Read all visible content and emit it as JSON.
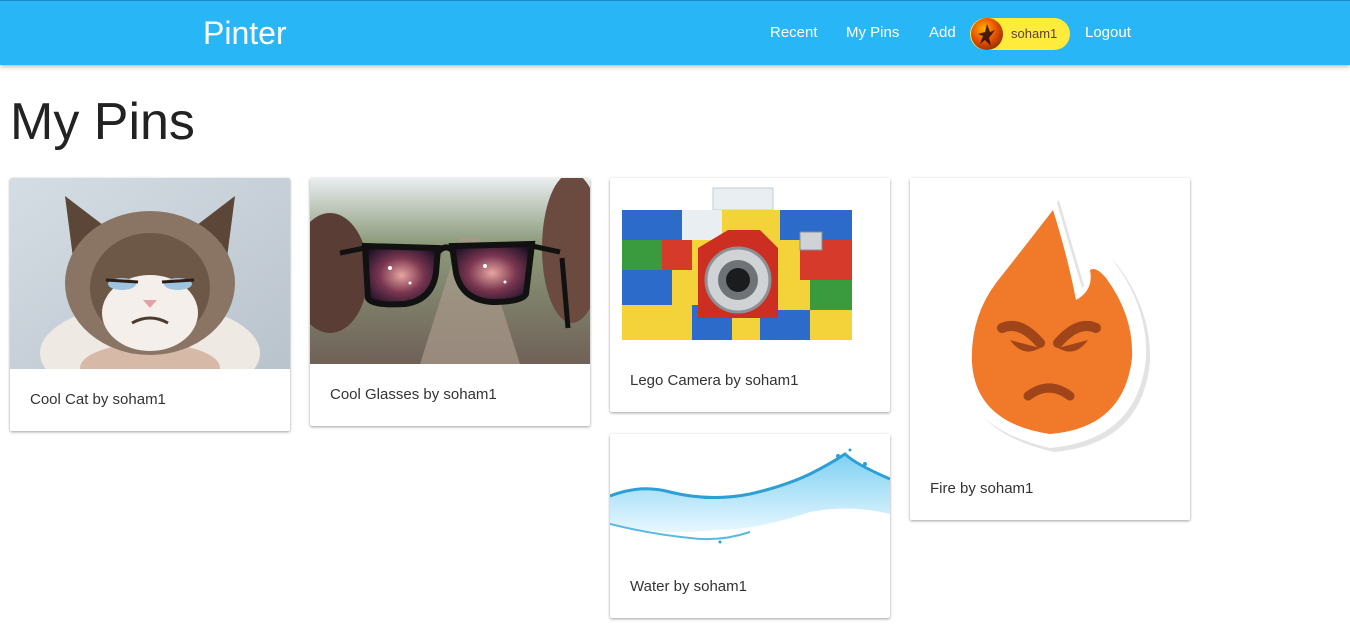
{
  "navbar": {
    "brand": "Pinter",
    "links": {
      "recent": "Recent",
      "my_pins": "My Pins",
      "add": "Add",
      "logout": "Logout"
    },
    "user": {
      "name": "soham1",
      "avatar_icon": "flame-avatar-icon"
    },
    "colors": {
      "bar": "#29b6f6",
      "chip": "#ffeb3b"
    }
  },
  "page": {
    "title": "My Pins"
  },
  "pins": [
    {
      "caption": "Cool Cat by soham1",
      "image": "grumpy-cat-image"
    },
    {
      "caption": "Cool Glasses by soham1",
      "image": "glasses-image"
    },
    {
      "caption": "Lego Camera by soham1",
      "image": "lego-camera-image"
    },
    {
      "caption": "Water by soham1",
      "image": "water-splash-image"
    },
    {
      "caption": "Fire by soham1",
      "image": "angry-fire-emoji-image"
    }
  ]
}
